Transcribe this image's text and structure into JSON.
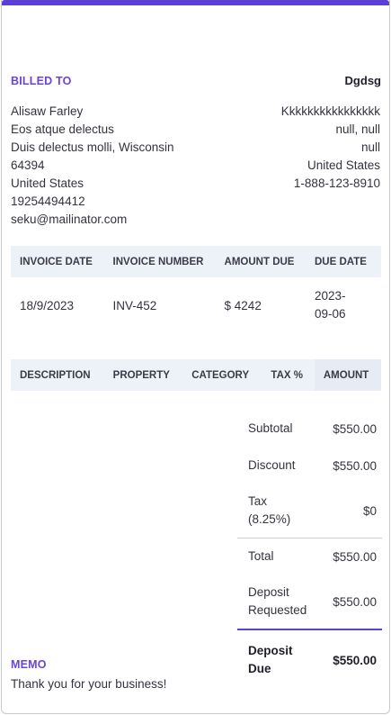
{
  "colors": {
    "accent": "#5b3fd6",
    "header_bg": "#edf1f8",
    "label_purple": "#6a44d6"
  },
  "billed_to": {
    "label": "BILLED TO",
    "client": [
      "Alisaw Farley",
      "Eos atque delectus",
      "Duis delectus molli, Wisconsin",
      "64394",
      "United States",
      "19254494412",
      "seku@mailinator.com"
    ]
  },
  "company": {
    "name": "Dgdsg",
    "lines": [
      "Kkkkkkkkkkkkkkkk",
      "null, null",
      "null",
      "United States",
      "1-888-123-8910"
    ]
  },
  "invoice_meta": {
    "headers": [
      "INVOICE DATE",
      "INVOICE NUMBER",
      "AMOUNT DUE",
      "DUE DATE"
    ],
    "invoice_date": "18/9/2023",
    "invoice_number": "INV-452",
    "amount_due": "$ 4242",
    "due_date_line1": "2023-",
    "due_date_line2": "09-06"
  },
  "items": {
    "headers": [
      "DESCRIPTION",
      "PROPERTY",
      "CATEGORY",
      "TAX %",
      "AMOUNT"
    ]
  },
  "totals": {
    "subtotal_label": "Subtotal",
    "subtotal_value": "$550.00",
    "discount_label": "Discount",
    "discount_value": "$550.00",
    "tax_label_line1": "Tax",
    "tax_label_line2": "(8.25%)",
    "tax_value": "$0",
    "total_label": "Total",
    "total_value": "$550.00",
    "deposit_label_line1": "Deposit",
    "deposit_label_line2": "Requested",
    "deposit_value": "$550.00",
    "due_label_line1": "Deposit",
    "due_label_line2": "Due",
    "due_value": "$550.00"
  },
  "memo": {
    "label": "MEMO",
    "text": "Thank you for your business!"
  }
}
